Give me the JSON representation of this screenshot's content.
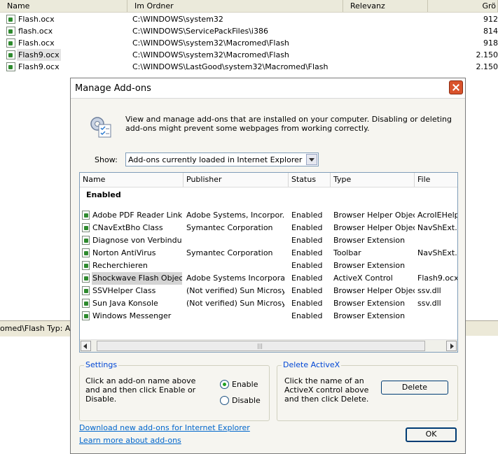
{
  "background": {
    "columns": [
      "Name",
      "Im Ordner",
      "Relevanz",
      "Grö"
    ],
    "rows": [
      {
        "name": "Flash.ocx",
        "folder": "C:\\WINDOWS\\system32",
        "size": "912"
      },
      {
        "name": "flash.ocx",
        "folder": "C:\\WINDOWS\\ServicePackFiles\\i386",
        "size": "814"
      },
      {
        "name": "Flash.ocx",
        "folder": "C:\\WINDOWS\\system32\\Macromed\\Flash",
        "size": "918"
      },
      {
        "name": "Flash9.ocx",
        "folder": "C:\\WINDOWS\\system32\\Macromed\\Flash",
        "size": "2.150"
      },
      {
        "name": "Flash9.ocx",
        "folder": "C:\\WINDOWS\\LastGood\\system32\\Macromed\\Flash",
        "size": "2.150"
      }
    ],
    "status_text": "omed\\Flash Typ: Act"
  },
  "dialog": {
    "title": "Manage Add-ons",
    "intro": "View and manage add-ons that are installed on your computer. Disabling or deleting add-ons might prevent some webpages from working correctly.",
    "show_label": "Show:",
    "show_value": "Add-ons currently loaded in Internet Explorer",
    "columns": [
      "Name",
      "Publisher",
      "Status",
      "Type",
      "File"
    ],
    "group_label": "Enabled",
    "addons": [
      {
        "name": "Adobe PDF Reader Link...",
        "publisher": "Adobe Systems, Incorpor...",
        "status": "Enabled",
        "type": "Browser Helper Object",
        "file": "AcroIEHelpe"
      },
      {
        "name": "CNavExtBho Class",
        "publisher": "Symantec Corporation",
        "status": "Enabled",
        "type": "Browser Helper Object",
        "file": "NavShExt.dl"
      },
      {
        "name": "Diagnose von Verbindu...",
        "publisher": "",
        "status": "Enabled",
        "type": "Browser Extension",
        "file": ""
      },
      {
        "name": "Norton AntiVirus",
        "publisher": "Symantec Corporation",
        "status": "Enabled",
        "type": "Toolbar",
        "file": "NavShExt.dl"
      },
      {
        "name": "Recherchieren",
        "publisher": "",
        "status": "Enabled",
        "type": "Browser Extension",
        "file": ""
      },
      {
        "name": "Shockwave Flash Object",
        "publisher": "Adobe Systems Incorpora...",
        "status": "Enabled",
        "type": "ActiveX Control",
        "file": "Flash9.ocx"
      },
      {
        "name": "SSVHelper Class",
        "publisher": "(Not verified) Sun Microsy...",
        "status": "Enabled",
        "type": "Browser Helper Object",
        "file": "ssv.dll"
      },
      {
        "name": "Sun Java Konsole",
        "publisher": "(Not verified) Sun Microsy...",
        "status": "Enabled",
        "type": "Browser Extension",
        "file": "ssv.dll"
      },
      {
        "name": "Windows Messenger",
        "publisher": "",
        "status": "Enabled",
        "type": "Browser Extension",
        "file": ""
      }
    ],
    "settings": {
      "title": "Settings",
      "desc": "Click an add-on name above and and then click Enable or Disable.",
      "enable_label": "Enable",
      "disable_label": "Disable"
    },
    "delete_activex": {
      "title": "Delete ActiveX",
      "desc": "Click the name of an ActiveX control above and then click Delete.",
      "button": "Delete"
    },
    "link_download": "Download new add-ons for Internet Explorer",
    "link_learn": "Learn more about add-ons",
    "ok_label": "OK"
  }
}
